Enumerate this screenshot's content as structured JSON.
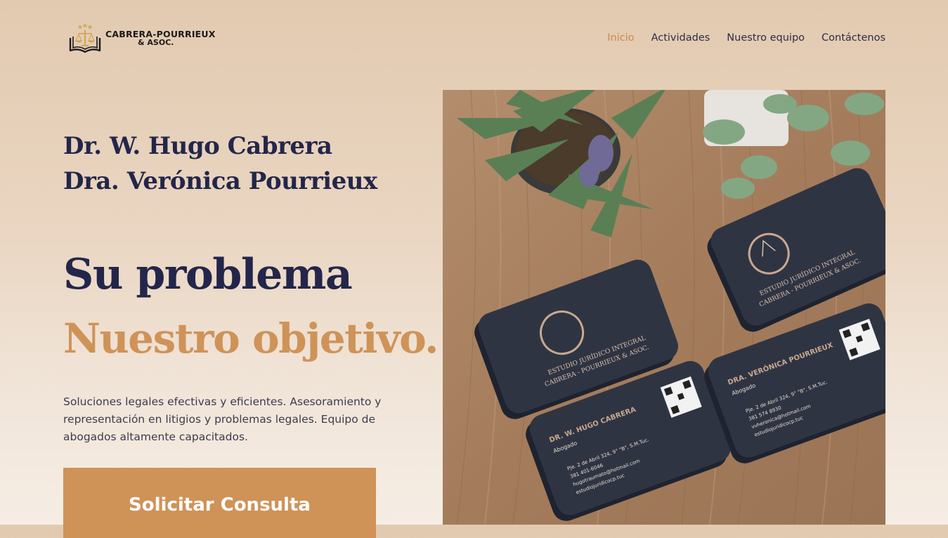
{
  "header": {
    "logo": {
      "line1": "CABRERA-POURRIEUX",
      "line2": "& ASOC."
    },
    "nav": [
      {
        "label": "Inicio",
        "active": true
      },
      {
        "label": "Actividades",
        "active": false
      },
      {
        "label": "Nuestro equipo",
        "active": false
      },
      {
        "label": "Contáctenos",
        "active": false
      }
    ]
  },
  "hero": {
    "names": [
      "Dr. W. Hugo Cabrera",
      "Dra. Verónica Pourrieux"
    ],
    "headline_primary": "Su problema",
    "headline_secondary": "Nuestro objetivo.",
    "description": "Soluciones legales efectivas y eficientes. Asesoramiento y representación en litigios y problemas legales. Equipo de abogados altamente capacitados.",
    "cta_label": "Solicitar Consulta"
  },
  "photo": {
    "card_firm_line1": "ESTUDIO JURÍDICO INTEGRAL",
    "card_firm_line2": "CABRERA - POURRIEUX & ASOC.",
    "card_name_1": "DR. W. HUGO CABRERA",
    "card_name_2": "DRA. VERÓNICA POURRIEUX",
    "card_title": "Abogado",
    "card1_lines": [
      "Pje. 2 de Abril 324, 9° \"B\", S.M.Tuc.",
      "381 401-6046",
      "hugotraumato@hotmail.com",
      "estudiojuridicocp.tuc"
    ],
    "card2_lines": [
      "Pje. 2 de Abril 324, 9° \"B\", S.M.Tuc.",
      "381 574 8930",
      "vvheronica@hotmail.com",
      "estudiojuridicocp.tuc"
    ]
  },
  "colors": {
    "navy": "#23264a",
    "accent": "#cf9358",
    "nav_active": "#c98a4b",
    "cta_bg": "#cf9257"
  },
  "icons": [
    "scales-of-justice-icon",
    "open-book-icon",
    "star-icon"
  ]
}
